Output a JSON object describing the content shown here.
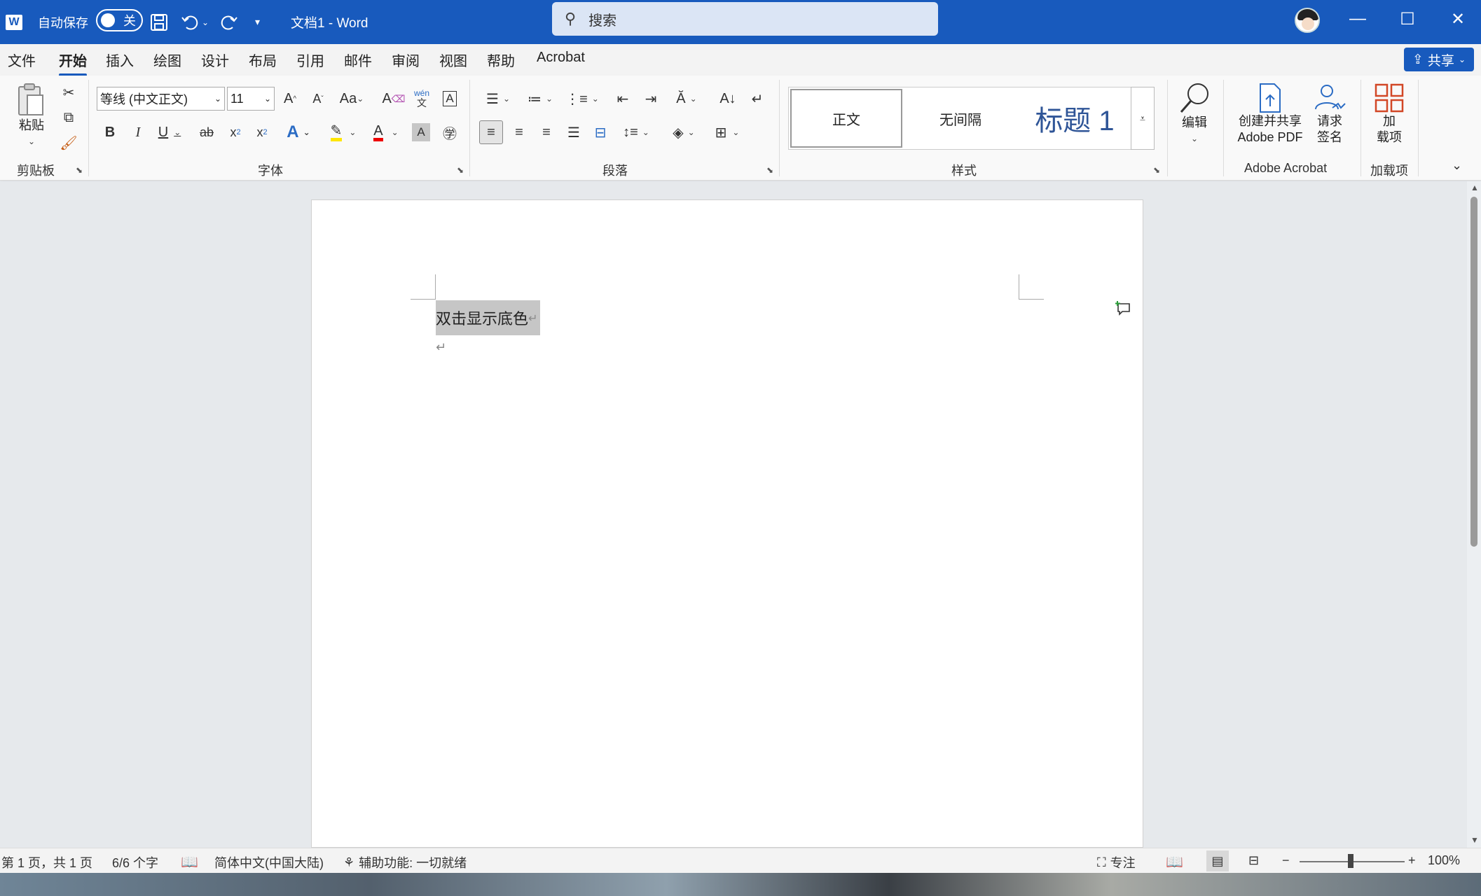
{
  "titlebar": {
    "app_icon": "word-logo-icon",
    "app_letter": "W",
    "autosave_label": "自动保存",
    "autosave_state": "关",
    "doc_title": "文档1  -  Word",
    "search_placeholder": "搜索",
    "accent_color": "#185abd"
  },
  "menu": {
    "tabs": [
      "文件",
      "开始",
      "插入",
      "绘图",
      "设计",
      "布局",
      "引用",
      "邮件",
      "审阅",
      "视图",
      "帮助",
      "Acrobat"
    ],
    "active_tab": "开始",
    "share_label": "共享"
  },
  "ribbon": {
    "clipboard": {
      "group_label": "剪贴板",
      "paste_label": "粘贴"
    },
    "font": {
      "group_label": "字体",
      "font_name": "等线 (中文正文)",
      "font_size": "11",
      "phonetic": "wén",
      "phonetic_char": "文"
    },
    "paragraph": {
      "group_label": "段落"
    },
    "styles": {
      "group_label": "样式",
      "items": [
        "正文",
        "无间隔",
        "标题 1"
      ]
    },
    "editing": {
      "label": "编辑"
    },
    "acrobat": {
      "group_label": "Adobe Acrobat",
      "create_share_label_1": "创建并共享",
      "create_share_label_2": "Adobe PDF",
      "request_sign_label_1": "请求",
      "request_sign_label_2": "签名"
    },
    "addins": {
      "group_label": "加载项",
      "label_1": "加",
      "label_2": "载项"
    }
  },
  "document": {
    "selected_text": "双击显示底色",
    "paragraph_mark": "↵"
  },
  "status": {
    "page": "第 1 页，共 1 页",
    "words": "6/6 个字",
    "language": "简体中文(中国大陆)",
    "accessibility": "辅助功能: 一切就绪",
    "focus": "专注",
    "zoom": "100%"
  }
}
